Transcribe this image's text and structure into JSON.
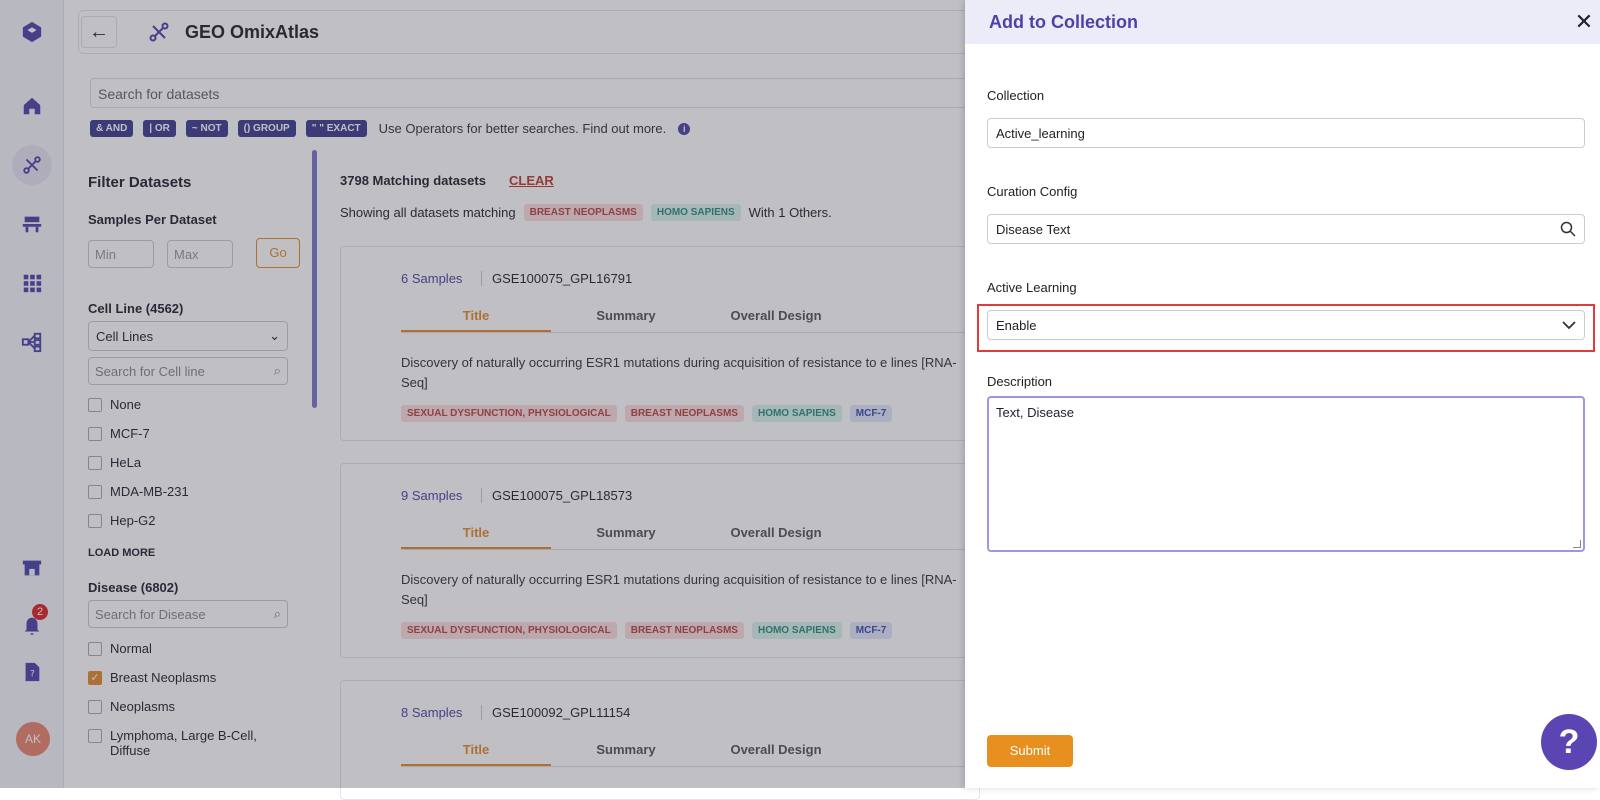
{
  "app": {
    "title": "GEO OmixAtlas"
  },
  "nav": {
    "notification_count": "2",
    "avatar_initials": "AK"
  },
  "search": {
    "placeholder": "Search for datasets"
  },
  "operators": [
    "& AND",
    "| OR",
    "~ NOT",
    "() GROUP",
    "\" \" EXACT"
  ],
  "operators_help": "Use Operators for better searches. Find out more.",
  "filters": {
    "title": "Filter Datasets",
    "samples_label": "Samples Per Dataset",
    "min_placeholder": "Min",
    "max_placeholder": "Max",
    "go": "Go",
    "cell_line_label": "Cell Line (4562)",
    "cell_line_select": "Cell Lines",
    "cell_line_search": "Search for Cell line",
    "cell_lines": [
      "None",
      "MCF-7",
      "HeLa",
      "MDA-MB-231",
      "Hep-G2"
    ],
    "load_more": "LOAD MORE",
    "disease_label": "Disease (6802)",
    "disease_search": "Search for Disease",
    "diseases": [
      {
        "label": "Normal",
        "checked": false
      },
      {
        "label": "Breast Neoplasms",
        "checked": true
      },
      {
        "label": "Neoplasms",
        "checked": false
      },
      {
        "label": "Lymphoma, Large B-Cell, Diffuse",
        "checked": false
      }
    ]
  },
  "results": {
    "count": "3798 Matching datasets",
    "clear": "CLEAR",
    "showing_prefix": "Showing all datasets matching",
    "tags": [
      "BREAST NEOPLASMS",
      "HOMO SAPIENS"
    ],
    "others": "With 1 Others.",
    "tabs": [
      "Title",
      "Summary",
      "Overall Design"
    ],
    "cards": [
      {
        "samples": "6 Samples",
        "id": "GSE100075_GPL16791",
        "desc": "Discovery of naturally occurring ESR1 mutations during acquisition of resistance to e lines [RNA-Seq]",
        "tags": [
          "SEXUAL DYSFUNCTION, PHYSIOLOGICAL",
          "BREAST NEOPLASMS",
          "HOMO SAPIENS",
          "MCF-7"
        ]
      },
      {
        "samples": "9 Samples",
        "id": "GSE100075_GPL18573",
        "desc": "Discovery of naturally occurring ESR1 mutations during acquisition of resistance to e lines [RNA-Seq]",
        "tags": [
          "SEXUAL DYSFUNCTION, PHYSIOLOGICAL",
          "BREAST NEOPLASMS",
          "HOMO SAPIENS",
          "MCF-7"
        ]
      },
      {
        "samples": "8 Samples",
        "id": "GSE100092_GPL11154",
        "desc": "",
        "tags": []
      }
    ]
  },
  "drawer": {
    "title": "Add to Collection",
    "collection_label": "Collection",
    "collection_value": "Active_learning",
    "curation_label": "Curation Config",
    "curation_value": "Disease Text",
    "active_label": "Active Learning",
    "active_value": "Enable",
    "description_label": "Description",
    "description_value": "Text, Disease",
    "submit": "Submit"
  },
  "help": {
    "label": "?"
  }
}
